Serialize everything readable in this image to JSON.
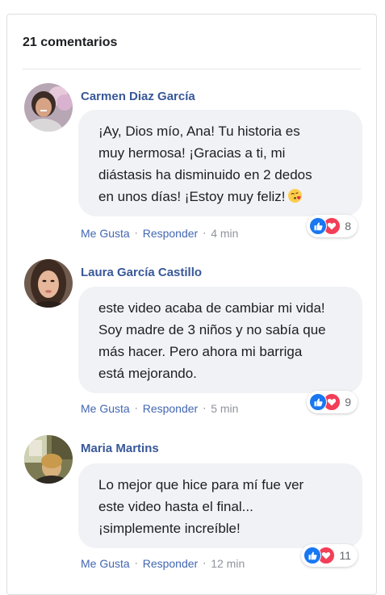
{
  "header": {
    "count_label": "21 comentarios"
  },
  "colors": {
    "author": "#385898",
    "link": "#4267b2",
    "bubble": "#f0f2f5",
    "like": "#1877f2",
    "love": "#f33e58"
  },
  "comments": [
    {
      "author": "Carmen Diaz García",
      "lines": [
        "¡Ay, Dios mío, Ana! Tu historia es",
        "muy hermosa! ¡Gracias a ti, mi",
        "diástasis ha disminuido en 2 dedos",
        "en unos días! ¡Estoy muy feliz!"
      ],
      "emoji": "face-blowing-kiss",
      "like_label": "Me Gusta",
      "reply_label": "Responder",
      "time": "4 min",
      "reaction_count": "8",
      "reactions": [
        "like-icon",
        "love-icon"
      ]
    },
    {
      "author": "Laura García Castillo",
      "lines": [
        "este video acaba de cambiar mi vida!",
        "Soy madre de 3 niños y no sabía que",
        "más hacer. Pero ahora mi barriga",
        "está mejorando."
      ],
      "like_label": "Me Gusta",
      "reply_label": "Responder",
      "time": "5 min",
      "reaction_count": "9",
      "reactions": [
        "like-icon",
        "love-icon"
      ]
    },
    {
      "author": "Maria Martins",
      "lines": [
        "Lo mejor que hice para mí fue ver",
        "este video hasta el final...",
        "¡simplemente increíble!"
      ],
      "like_label": "Me Gusta",
      "reply_label": "Responder",
      "time": "12 min",
      "reaction_count": "11",
      "reactions": [
        "like-icon",
        "love-icon"
      ]
    }
  ]
}
